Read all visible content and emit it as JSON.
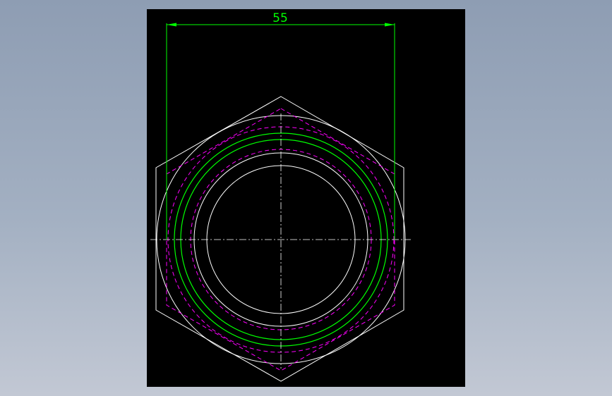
{
  "drawing": {
    "dimension_label": "55"
  },
  "colors": {
    "background": "#000000",
    "outline": "#ffffff",
    "thread": "#00ff00",
    "hidden": "#ff00ff",
    "dimension": "#00ff00"
  }
}
